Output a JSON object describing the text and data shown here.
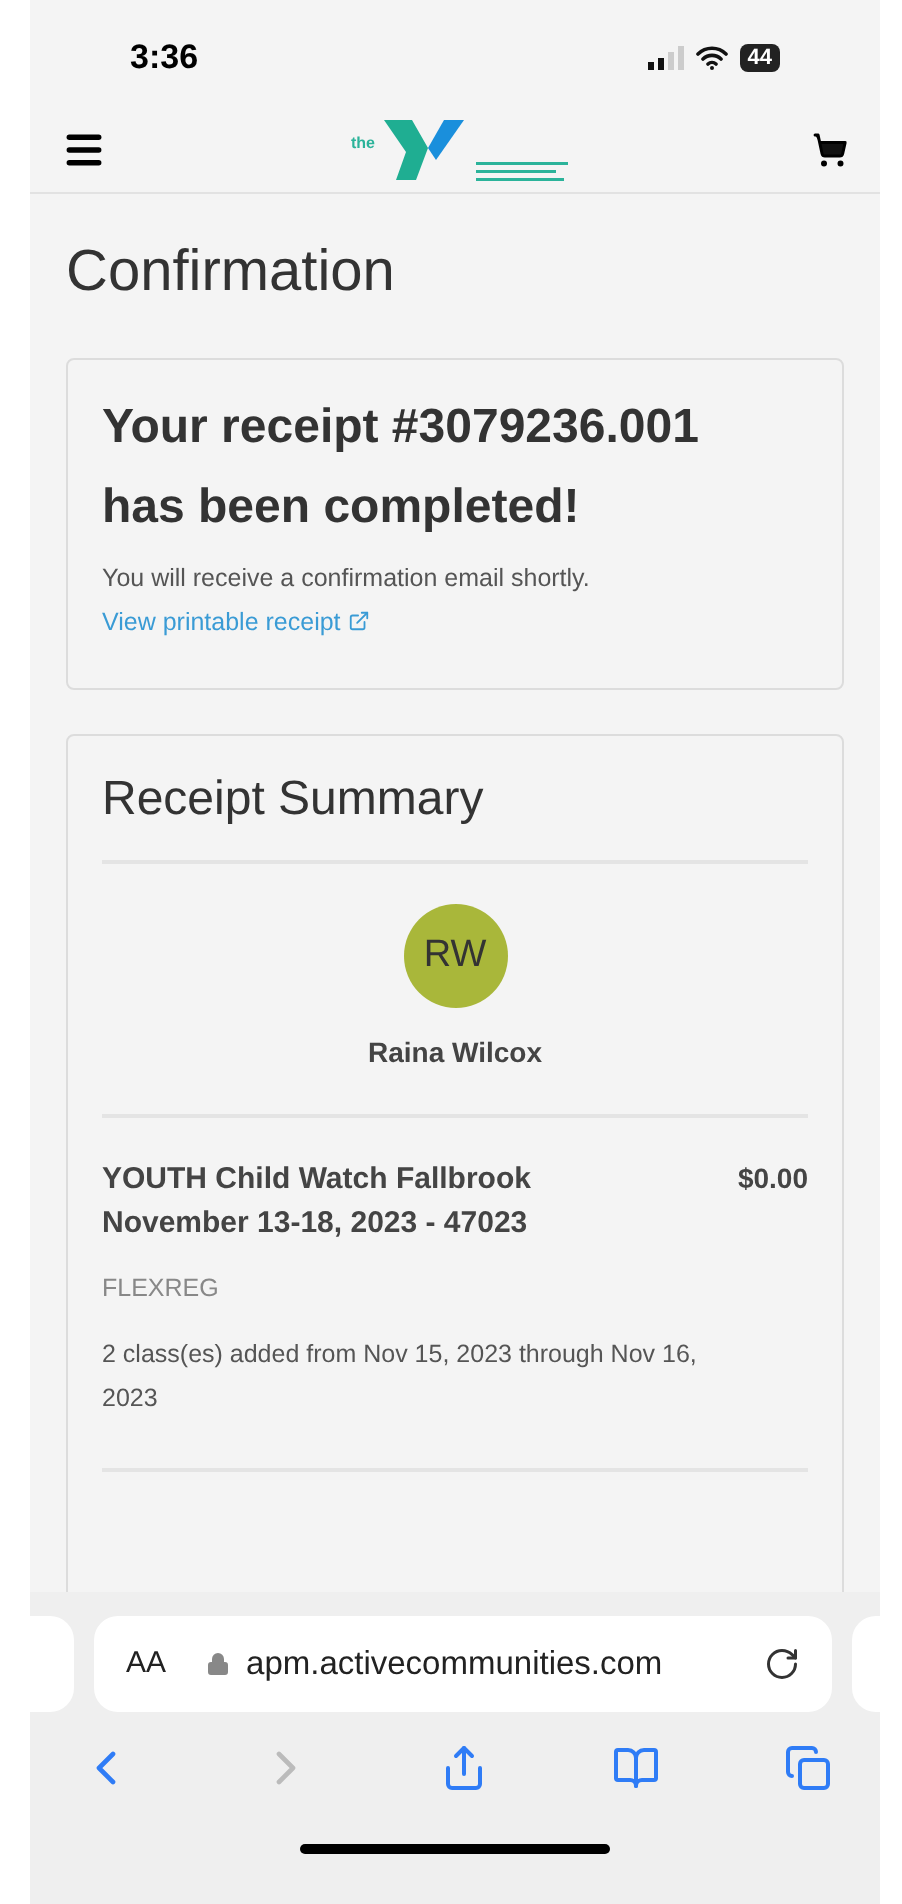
{
  "status_bar": {
    "time": "3:36",
    "battery": "44"
  },
  "header": {
    "logo_text": "the"
  },
  "page_title": "Confirmation",
  "confirmation": {
    "heading": "Your receipt #3079236.001 has been completed!",
    "message": "You will receive a confirmation email shortly.",
    "link": "View printable receipt"
  },
  "summary": {
    "title": "Receipt Summary",
    "avatar_initials": "RW",
    "participant": "Raina Wilcox",
    "items": [
      {
        "name": "YOUTH Child Watch Fallbrook November 13-18, 2023 - 47023",
        "price": "$0.00",
        "code": "FLEXREG",
        "note": "2 class(es) added from Nov 15, 2023 through Nov 16, 2023"
      }
    ]
  },
  "browser": {
    "text_size": "AA",
    "url": "apm.activecommunities.com",
    "back": {
      "disabled": false
    },
    "forward": {
      "disabled": true
    }
  }
}
